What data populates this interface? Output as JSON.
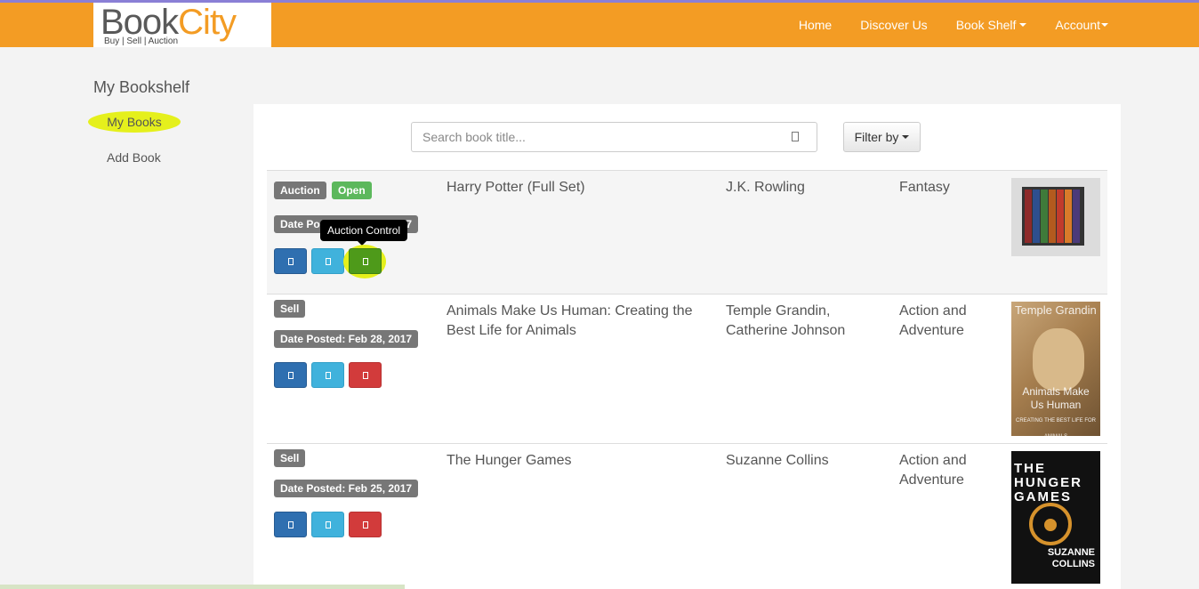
{
  "brand": {
    "name_part1": "Book",
    "name_part2": "City",
    "tagline": "Buy | Sell | Auction"
  },
  "nav": {
    "home": "Home",
    "discover": "Discover Us",
    "bookshelf": "Book Shelf",
    "account": "Account"
  },
  "sidebar": {
    "title": "My Bookshelf",
    "items": [
      {
        "label": "My Books"
      },
      {
        "label": "Add Book"
      }
    ]
  },
  "toolbar": {
    "search_placeholder": "Search book title...",
    "filter_label": "Filter by"
  },
  "tooltip": {
    "text": "Auction Control"
  },
  "books": [
    {
      "type": "Auction",
      "status": "Open",
      "date": "Date Posted: Mar 05, 2017",
      "title": "Harry Potter (Full Set)",
      "author": "J.K. Rowling",
      "genre": "Fantasy"
    },
    {
      "type": "Sell",
      "date": "Date Posted: Feb 28, 2017",
      "title": "Animals Make Us Human: Creating the Best Life for Animals",
      "author": "Temple Grandin, Catherine Johnson",
      "genre": "Action and Adventure",
      "cover": {
        "author": "Temple Grandin",
        "title": "Animals Make Us Human",
        "subtitle": "CREATING THE BEST LIFE FOR ANIMALS"
      }
    },
    {
      "type": "Sell",
      "date": "Date Posted: Feb 25, 2017",
      "title": "The Hunger Games",
      "author": "Suzanne Collins",
      "genre": "Action and Adventure",
      "cover": {
        "title": "THE HUNGER GAMES",
        "author": "SUZANNE COLLINS"
      }
    }
  ],
  "colors": {
    "accent": "#f39c24",
    "highlight": "#e5f01c"
  }
}
